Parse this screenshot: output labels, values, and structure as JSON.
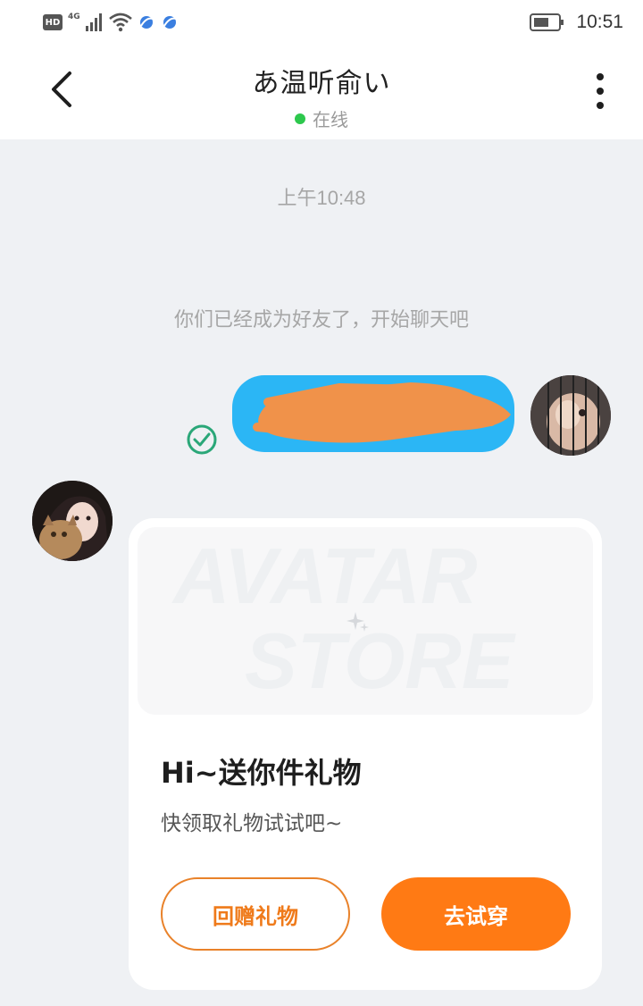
{
  "status_bar": {
    "hd_label": "HD",
    "network_label": "4G",
    "time": "10:51"
  },
  "header": {
    "title": "あ温听俞い",
    "status_text": "在线",
    "status_color": "#2dc84d"
  },
  "chat": {
    "timestamp": "上午10:48",
    "system_message": "你们已经成为好友了，开始聊天吧",
    "my_bubble_color": "#2bb6f5",
    "redaction_color": "#f0924a"
  },
  "gift_card": {
    "banner_watermark_line1": "AVATAR",
    "banner_watermark_line2": "STORE",
    "title": "Hi~送你件礼物",
    "subtitle": "快领取礼物试试吧~",
    "return_gift_label": "回赠礼物",
    "try_on_label": "去试穿",
    "accent_color": "#ff7a14"
  },
  "icons": {
    "back": "chevron-left-icon",
    "more": "more-vertical-icon",
    "sent": "check-circle-icon"
  }
}
